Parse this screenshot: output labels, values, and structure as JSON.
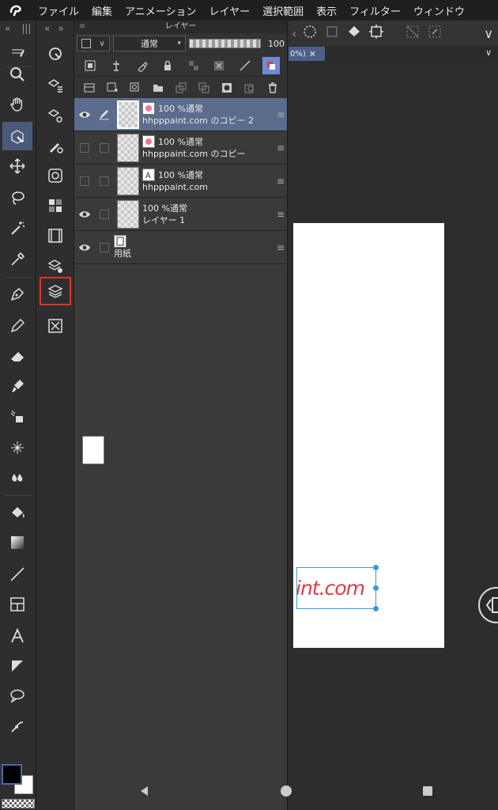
{
  "menubar": {
    "items": [
      "ファイル",
      "編集",
      "アニメーション",
      "レイヤー",
      "選択範囲",
      "表示",
      "フィルター",
      "ウィンドウ"
    ]
  },
  "toolbar": {
    "tools": [
      "zoom-tool",
      "move-tool",
      "operation-tool",
      "move-layer-tool",
      "lasso-selection-tool",
      "auto-select-tool",
      "eyedropper-tool",
      "pen-tool",
      "pencil-tool",
      "eraser-tool",
      "brush-tool",
      "airbrush-tool",
      "decoration-tool",
      "blend-tool",
      "fill-tool",
      "gradient-tool",
      "line-tool",
      "frame-tool",
      "text-tool",
      "ruler-tool",
      "balloon-tool",
      "correction-tool"
    ],
    "active": "operation-tool"
  },
  "subtool": {
    "items": [
      "navigator",
      "layer-property",
      "sub-tool-detail",
      "brush-size",
      "tool-property",
      "color-set",
      "animation-timeline",
      "material",
      "layer",
      "layer-search"
    ],
    "highlighted": "layer"
  },
  "layer_panel": {
    "title": "レイヤー",
    "blend_mode": "通常",
    "opacity": "100",
    "layers": [
      {
        "line1": "100 %通常",
        "name": "hhpppaint.com のコピー 2",
        "visible": true,
        "selected": true,
        "type": "text"
      },
      {
        "line1": "100 %通常",
        "name": "hhpppaint.com のコピー",
        "visible": false,
        "selected": false,
        "type": "text"
      },
      {
        "line1": "100 %通常",
        "name": "hhpppaint.com",
        "visible": false,
        "selected": false,
        "type": "text"
      },
      {
        "line1": "100 %通常",
        "name": "レイヤー 1",
        "visible": true,
        "selected": false,
        "type": "raster"
      },
      {
        "line1": "",
        "name": "用紙",
        "visible": true,
        "selected": false,
        "type": "paper"
      }
    ]
  },
  "canvas": {
    "tab_label": "0%)",
    "text_content": "int.com",
    "text_color": "#e33a44",
    "selection_color": "#3b9adf"
  },
  "colors": {
    "main": "#000000",
    "sub": "#ffffff",
    "accent": "#4a5a7a",
    "highlight": "#e2322b"
  }
}
